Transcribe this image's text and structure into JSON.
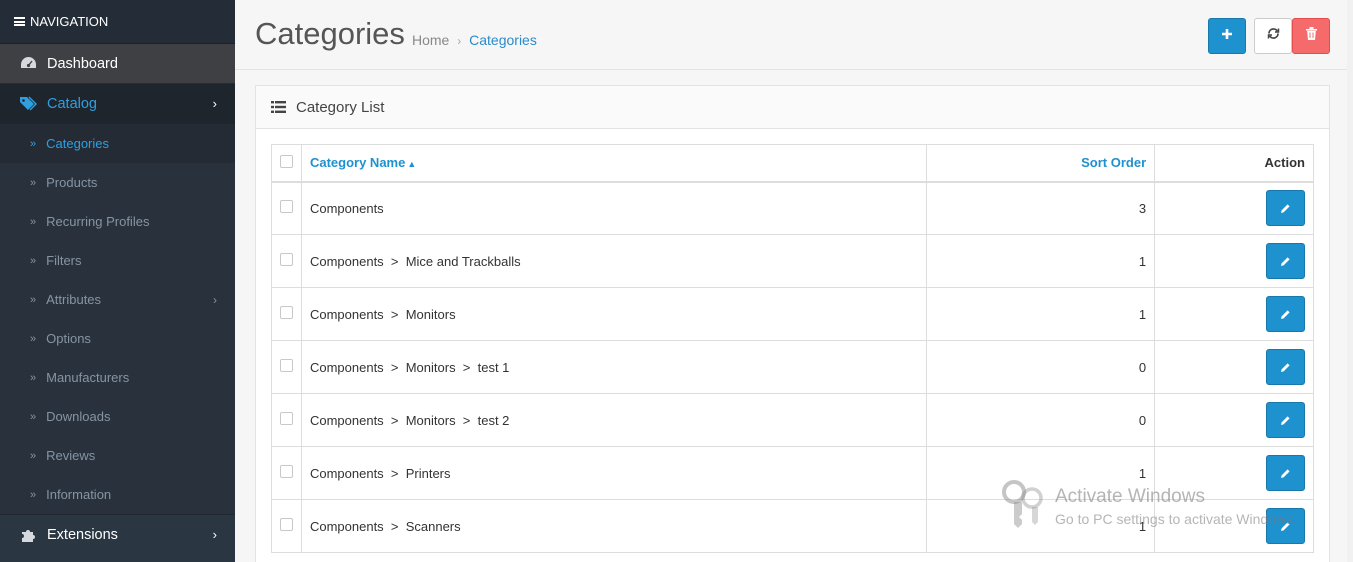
{
  "nav": {
    "header": "NAVIGATION",
    "dashboard": "Dashboard",
    "catalog": "Catalog",
    "sub_items": [
      {
        "label": "Categories"
      },
      {
        "label": "Products"
      },
      {
        "label": "Recurring Profiles"
      },
      {
        "label": "Filters"
      },
      {
        "label": "Attributes"
      },
      {
        "label": "Options"
      },
      {
        "label": "Manufacturers"
      },
      {
        "label": "Downloads"
      },
      {
        "label": "Reviews"
      },
      {
        "label": "Information"
      }
    ],
    "extensions": "Extensions"
  },
  "header": {
    "title": "Categories",
    "breadcrumb": [
      "Home",
      "Categories"
    ]
  },
  "panel": {
    "title": "Category List"
  },
  "table": {
    "columns": {
      "name": "Category Name",
      "sort": "Sort Order",
      "action": "Action"
    },
    "rows": [
      {
        "name": "Components",
        "sort": "3"
      },
      {
        "name": "Components  >  Mice and Trackballs",
        "sort": "1"
      },
      {
        "name": "Components  >  Monitors",
        "sort": "1"
      },
      {
        "name": "Components  >  Monitors  >  test 1",
        "sort": "0"
      },
      {
        "name": "Components  >  Monitors  >  test 2",
        "sort": "0"
      },
      {
        "name": "Components  >  Printers",
        "sort": "1"
      },
      {
        "name": "Components  >  Scanners",
        "sort": "1"
      }
    ]
  },
  "watermark": {
    "title": "Activate Windows",
    "subtitle": "Go to PC settings to activate Windows."
  },
  "colors": {
    "accent": "#1e91cf",
    "sidebar": "#2b3643",
    "danger": "#f56b6b"
  }
}
